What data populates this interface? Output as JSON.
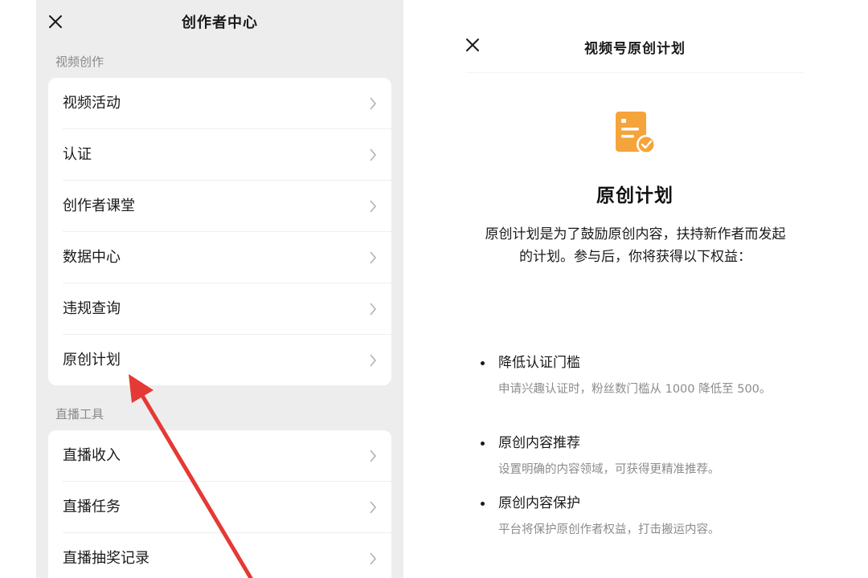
{
  "left": {
    "title": "创作者中心",
    "sections": [
      {
        "label": "视频创作",
        "items": [
          "视频活动",
          "认证",
          "创作者课堂",
          "数据中心",
          "违规查询",
          "原创计划"
        ]
      },
      {
        "label": "直播工具",
        "items": [
          "直播收入",
          "直播任务",
          "直播抽奖记录"
        ]
      }
    ]
  },
  "right": {
    "title": "视频号原创计划",
    "heading": "原创计划",
    "description": "原创计划是为了鼓励原创内容，扶持新作者而发起的计划。参与后，你将获得以下权益：",
    "benefits": [
      {
        "title": "降低认证门槛",
        "desc": "申请兴趣认证时，粉丝数门槛从 1000 降低至 500。"
      },
      {
        "title": "原创内容推荐",
        "desc": "设置明确的内容领域，可获得更精准推荐。"
      },
      {
        "title": "原创内容保护",
        "desc": "平台将保护原创作者权益，打击搬运内容。"
      }
    ]
  },
  "colors": {
    "panel_bg": "#ededed",
    "card_bg": "#ffffff",
    "accent_orange": "#f5a43b",
    "annotation_red": "#e53935",
    "secondary_text": "#8c8c8c"
  },
  "icons": {
    "close": "close-icon",
    "chevron": "chevron-right-icon",
    "document": "document-check-icon"
  }
}
